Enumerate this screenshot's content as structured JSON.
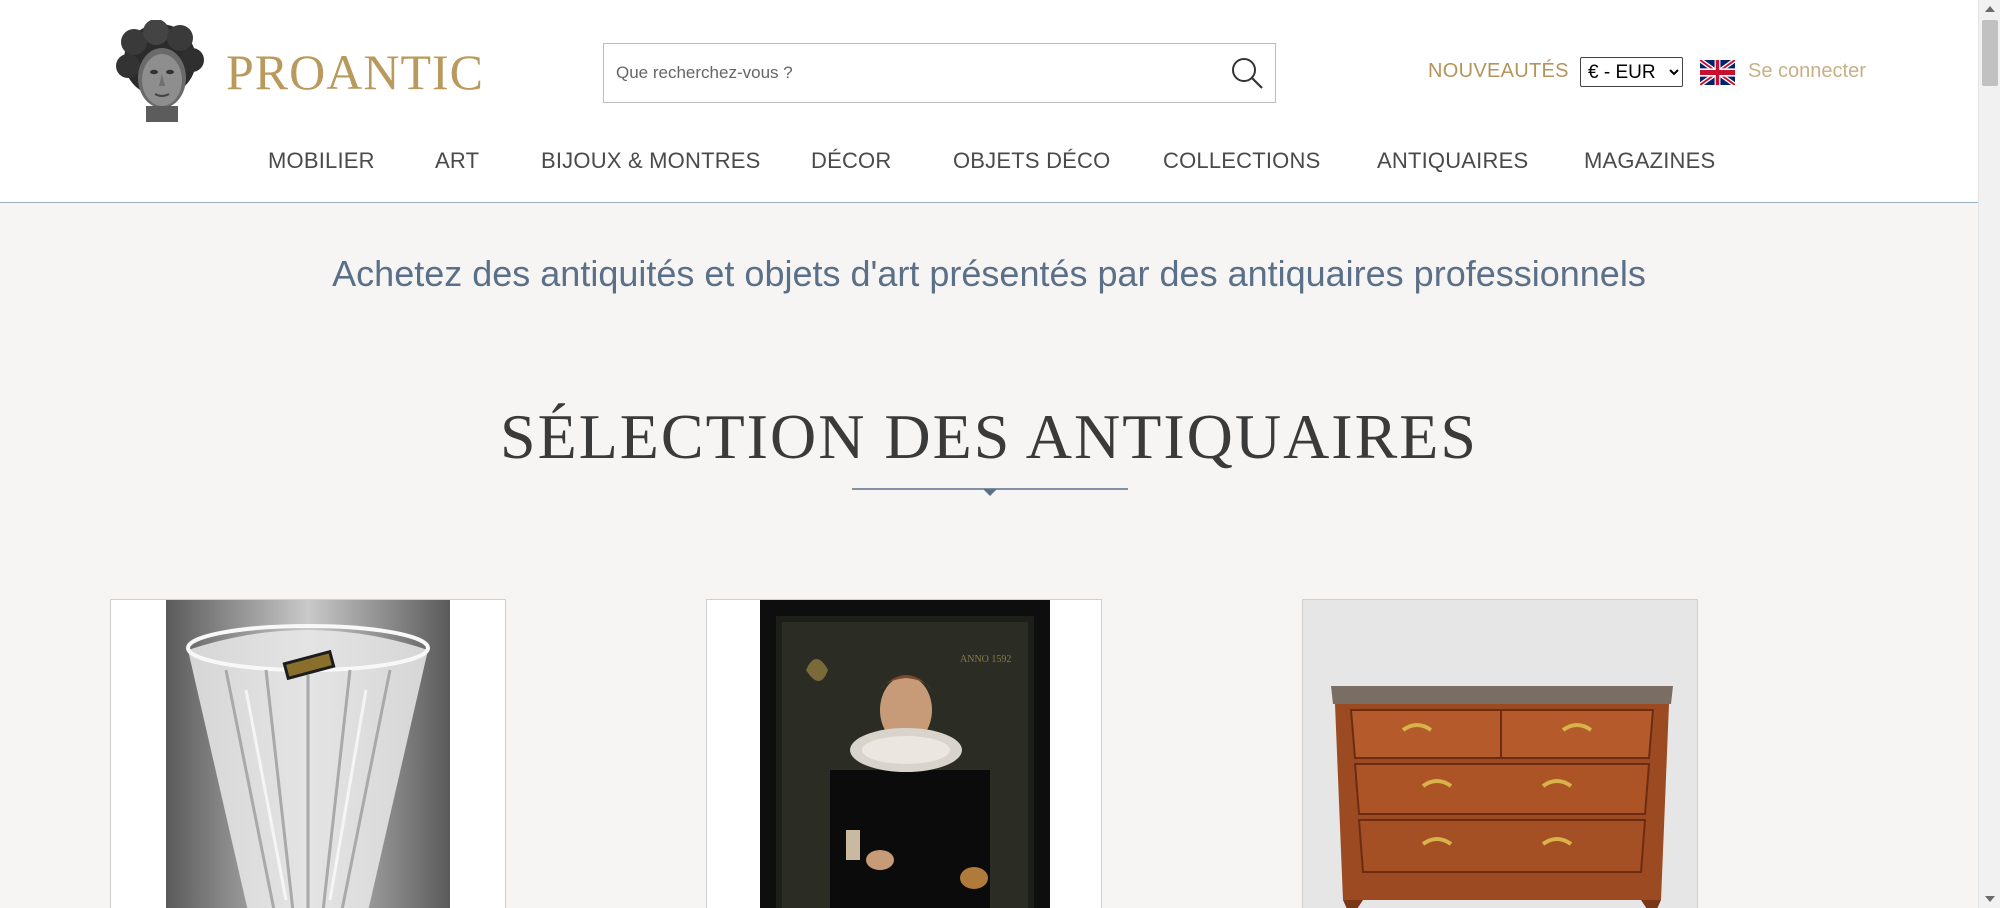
{
  "header": {
    "logo_text": "PROANTIC",
    "search_placeholder": "Que recherchez-vous ?",
    "new_label": "NOUVEAUTÉS",
    "currency": {
      "selected": "€ - EUR",
      "options": [
        "€ - EUR"
      ]
    },
    "language_flag": "uk-flag-icon",
    "login_label": "Se connecter",
    "colors": {
      "gold": "#b99a5c",
      "slate": "#5a6f88"
    }
  },
  "nav": {
    "items": [
      {
        "label": "MOBILIER"
      },
      {
        "label": "ART"
      },
      {
        "label": "BIJOUX & MONTRES"
      },
      {
        "label": "DÉCOR"
      },
      {
        "label": "OBJETS DÉCO"
      },
      {
        "label": "COLLECTIONS"
      },
      {
        "label": "ANTIQUAIRES"
      },
      {
        "label": "MAGAZINES"
      }
    ]
  },
  "main": {
    "tagline": "Achetez des antiquités et objets d'art présentés par des antiquaires professionnels",
    "section_title": "SÉLECTION DES ANTIQUAIRES",
    "products": [
      {
        "image": "crystal-vase-image"
      },
      {
        "image": "ruff-portrait-painting-image"
      },
      {
        "image": "marble-top-commode-image"
      }
    ]
  }
}
